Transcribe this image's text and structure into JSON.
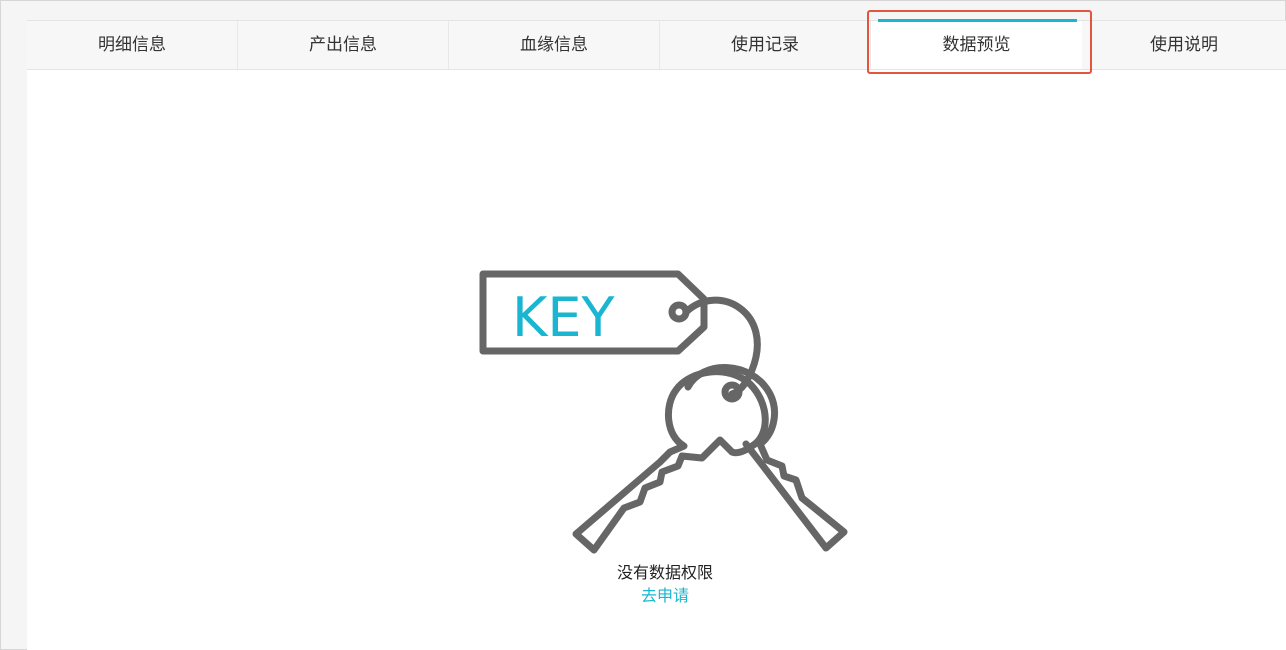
{
  "tabs": [
    {
      "label": "明细信息"
    },
    {
      "label": "产出信息"
    },
    {
      "label": "血缘信息"
    },
    {
      "label": "使用记录"
    },
    {
      "label": "数据预览"
    },
    {
      "label": "使用说明"
    }
  ],
  "active_tab": "数据预览",
  "illustration": {
    "tag_text": "KEY",
    "icon": "keys-icon"
  },
  "empty_state": {
    "message": "没有数据权限",
    "apply_link": "去申请"
  },
  "colors": {
    "accent": "#1ab6d1",
    "highlight": "#e2563d",
    "icon_stroke": "#666666"
  }
}
